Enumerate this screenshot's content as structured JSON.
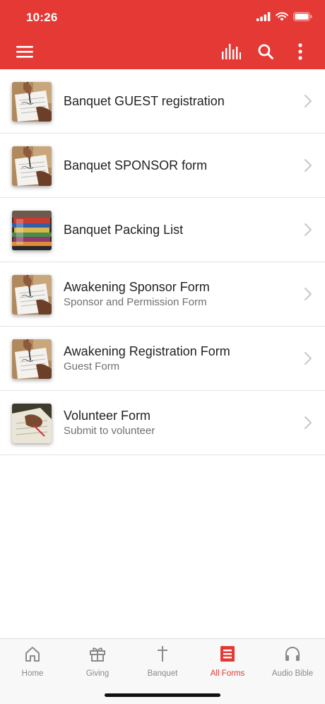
{
  "status_bar": {
    "time": "10:26"
  },
  "colors": {
    "accent": "#e53935",
    "tab_inactive": "#8a8a8a",
    "row_title": "#222222",
    "row_subtitle": "#6f6f6f"
  },
  "toolbar": {
    "menu_icon": "hamburger-menu-icon",
    "actions": [
      "bar-chart-icon",
      "search-icon",
      "more-vertical-icon"
    ]
  },
  "forms": [
    {
      "title": "Banquet GUEST registration",
      "subtitle": "",
      "thumb": "writing-on-paper"
    },
    {
      "title": "Banquet SPONSOR form",
      "subtitle": "",
      "thumb": "writing-on-paper"
    },
    {
      "title": "Banquet Packing List",
      "subtitle": "",
      "thumb": "stacked-colorful-items"
    },
    {
      "title": "Awakening Sponsor Form",
      "subtitle": "Sponsor and Permission Form",
      "thumb": "writing-on-paper"
    },
    {
      "title": "Awakening Registration Form",
      "subtitle": "Guest Form",
      "thumb": "writing-on-paper"
    },
    {
      "title": "Volunteer Form",
      "subtitle": "Submit to volunteer",
      "thumb": "hand-writing-dark"
    }
  ],
  "tabs": [
    {
      "label": "Home",
      "icon": "home-icon",
      "active": false
    },
    {
      "label": "Giving",
      "icon": "gift-icon",
      "active": false
    },
    {
      "label": "Banquet",
      "icon": "cross-icon",
      "active": false
    },
    {
      "label": "All Forms",
      "icon": "form-list-icon",
      "active": true
    },
    {
      "label": "Audio Bible",
      "icon": "headphones-icon",
      "active": false
    }
  ]
}
